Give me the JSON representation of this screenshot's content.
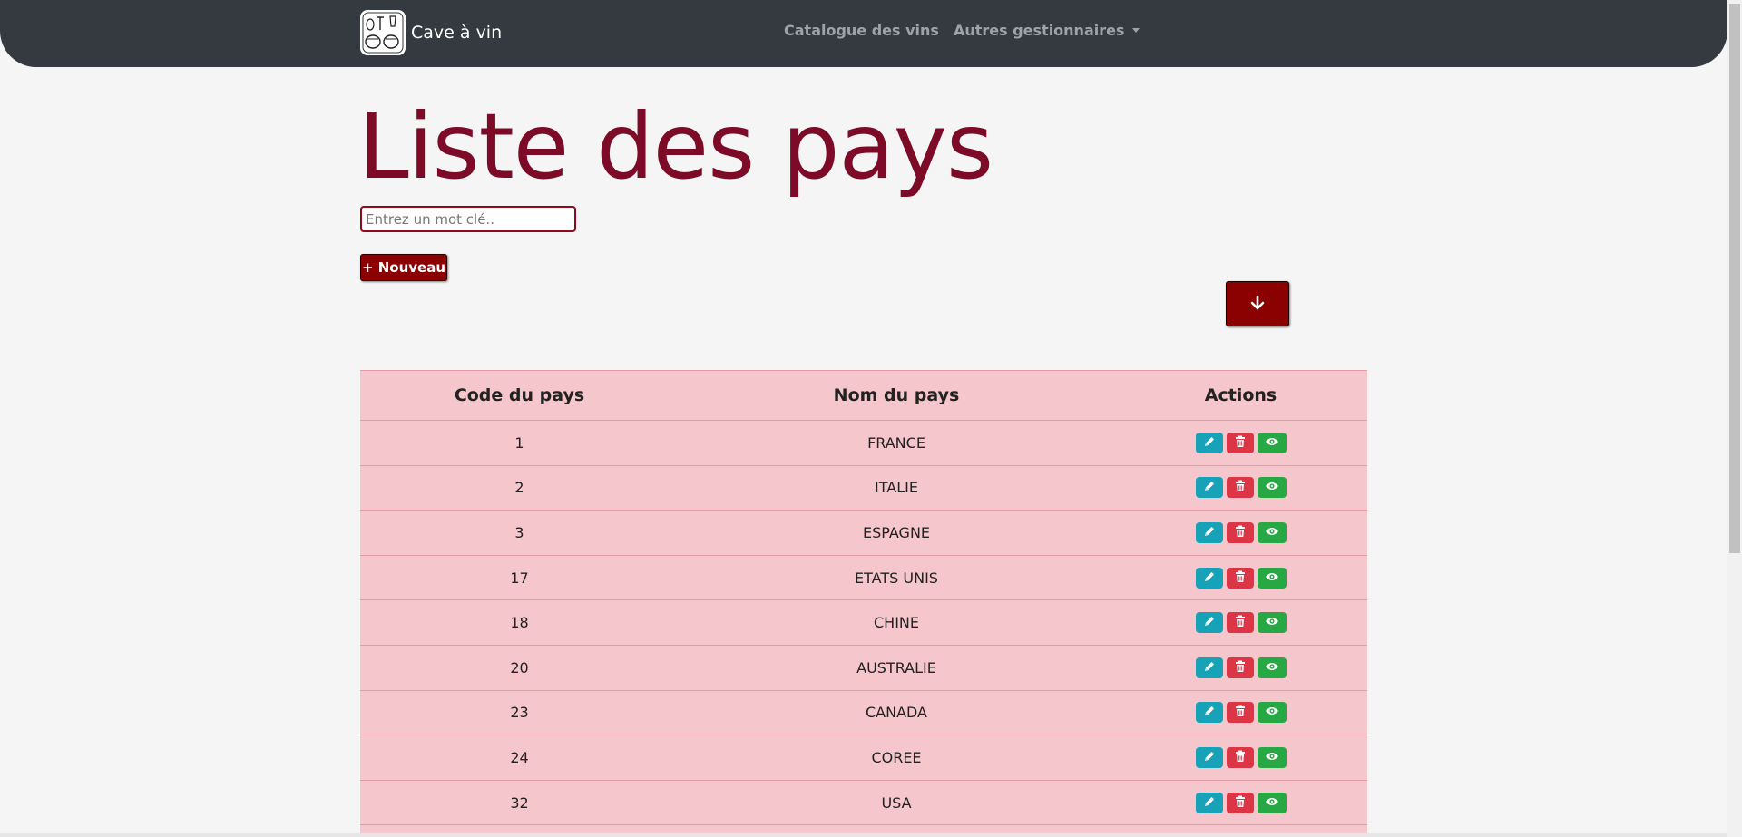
{
  "navbar": {
    "brand_name": "Cave à vin",
    "links": [
      {
        "label": "Catalogue des vins"
      },
      {
        "label": "Autres gestionnaires"
      }
    ]
  },
  "page": {
    "title": "Liste des pays",
    "search_placeholder": "Entrez un mot clé..",
    "new_button_label": "+ Nouveau"
  },
  "table": {
    "headers": [
      "Code du pays",
      "Nom du pays",
      "Actions"
    ],
    "rows": [
      {
        "code": "1",
        "name": "FRANCE"
      },
      {
        "code": "2",
        "name": "ITALIE"
      },
      {
        "code": "3",
        "name": "ESPAGNE"
      },
      {
        "code": "17",
        "name": "ETATS UNIS"
      },
      {
        "code": "18",
        "name": "CHINE"
      },
      {
        "code": "20",
        "name": "AUSTRALIE"
      },
      {
        "code": "23",
        "name": "CANADA"
      },
      {
        "code": "24",
        "name": "COREE"
      },
      {
        "code": "32",
        "name": "USA"
      }
    ]
  },
  "colors": {
    "navbar": "#343a40",
    "title": "#7d0a26",
    "primary_button": "#8b0000",
    "table_bg": "#f5c6cb",
    "edit": "#17a2b8",
    "delete": "#dc3545",
    "view": "#28a745"
  },
  "icons": {
    "edit": "pencil-icon",
    "delete": "trash-icon",
    "view": "eye-icon",
    "sort": "arrow-down-icon"
  }
}
